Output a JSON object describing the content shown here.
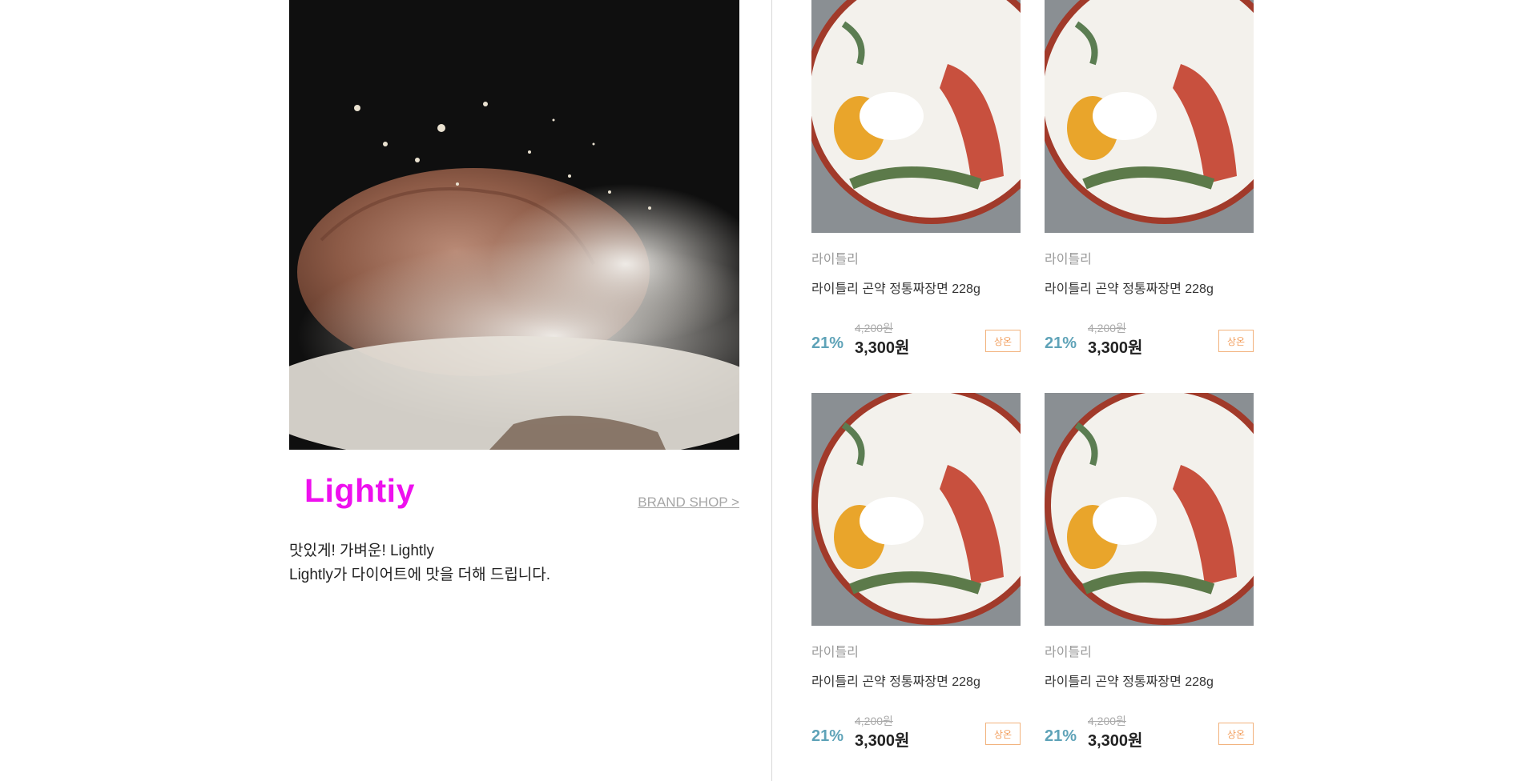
{
  "brand": {
    "logo_text": "Lightiy",
    "link_label": "BRAND SHOP >",
    "description_line1": "맛있게! 가벼운! Lightly",
    "description_line2": "Lightly가 다이어트에 맛을 더해 드립니다."
  },
  "products": [
    {
      "brand": "라이틀리",
      "title": "라이틀리 곤약 정통짜장면 228g",
      "original_price": "4,200원",
      "discount": "21%",
      "price": "3,300원",
      "badge": "상온"
    },
    {
      "brand": "라이틀리",
      "title": "라이틀리 곤약 정통짜장면 228g",
      "original_price": "4,200원",
      "discount": "21%",
      "price": "3,300원",
      "badge": "상온"
    },
    {
      "brand": "라이틀리",
      "title": "라이틀리 곤약 정통짜장면 228g",
      "original_price": "4,200원",
      "discount": "21%",
      "price": "3,300원",
      "badge": "상온"
    },
    {
      "brand": "라이틀리",
      "title": "라이틀리 곤약 정통짜장면 228g",
      "original_price": "4,200원",
      "discount": "21%",
      "price": "3,300원",
      "badge": "상온"
    }
  ],
  "colors": {
    "logo": "#ee10ee",
    "discount": "#5fa3b8",
    "badge": "#f2a060"
  }
}
